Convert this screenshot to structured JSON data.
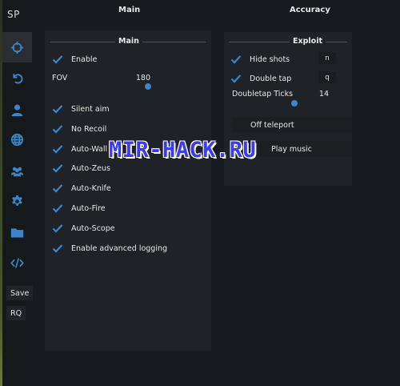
{
  "logo": "SP",
  "colors": {
    "accent": "#3a86c8",
    "background": "#171a1e",
    "panel": "#1f2226"
  },
  "sidebar": {
    "icons": [
      "crosshair-icon",
      "undo-icon",
      "user-icon",
      "globe-icon",
      "users-icon",
      "gear-icon",
      "folder-icon",
      "code-icon"
    ],
    "active_index": 0,
    "save_label": "Save",
    "rq_label": "RQ"
  },
  "tabs": {
    "main": "Main",
    "accuracy": "Accuracy"
  },
  "main_group": {
    "title": "Main",
    "enable_label": "Enable",
    "fov": {
      "label": "FOV",
      "value": "180"
    },
    "checkboxes": [
      {
        "label": "Silent aim",
        "checked": true
      },
      {
        "label": "No Recoil",
        "checked": true
      },
      {
        "label": "Auto-Wall",
        "checked": true
      },
      {
        "label": "Auto-Zeus",
        "checked": true
      },
      {
        "label": "Auto-Knife",
        "checked": true
      },
      {
        "label": "Auto-Fire",
        "checked": true
      },
      {
        "label": "Auto-Scope",
        "checked": true
      },
      {
        "label": "Enable advanced logging",
        "checked": true
      }
    ]
  },
  "exploit_group": {
    "title": "Exploit",
    "hide_shots": {
      "label": "Hide shots",
      "key": "n",
      "checked": true
    },
    "double_tap": {
      "label": "Double tap",
      "key": "q",
      "checked": true
    },
    "doubletap_ticks": {
      "label": "Doubletap Ticks",
      "value": "14"
    },
    "off_teleport_label": "Off teleport",
    "play_music_label": "Play music"
  },
  "watermark": "MIR-HACK.RU"
}
